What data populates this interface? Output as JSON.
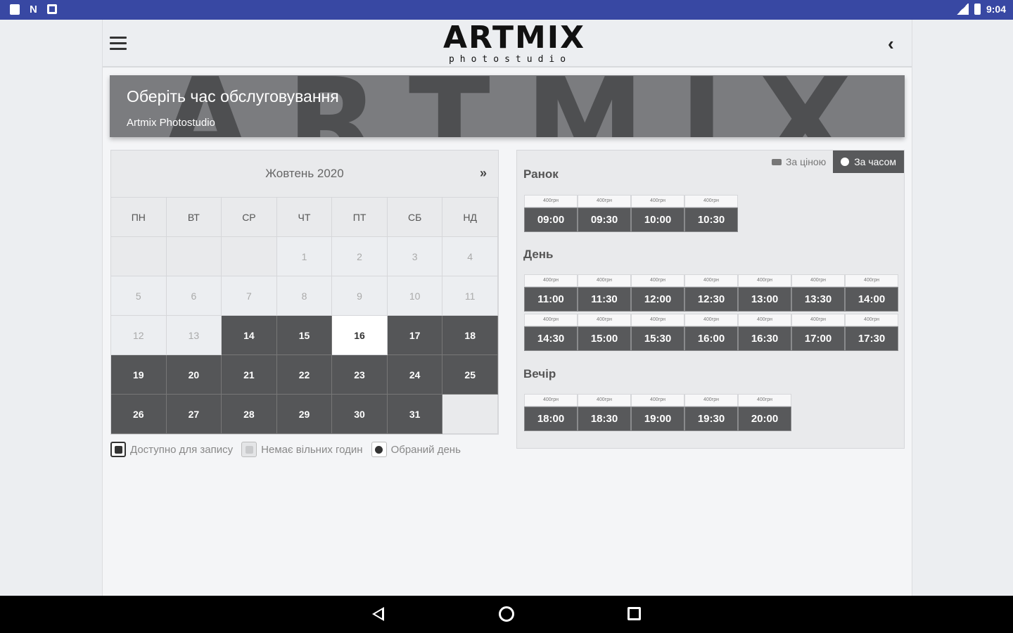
{
  "status_bar": {
    "time": "9:04"
  },
  "header": {
    "logo_main": "ARTMIX",
    "logo_sub": "photostudio"
  },
  "banner": {
    "title": "Оберіть час обслуговування",
    "subtitle": "Artmix Photostudio",
    "watermark": "ARTMIX"
  },
  "calendar": {
    "month": "Жовтень 2020",
    "next_label": "»",
    "weekdays": [
      "ПН",
      "ВТ",
      "СР",
      "ЧТ",
      "ПТ",
      "СБ",
      "НД"
    ],
    "days": [
      {
        "d": "",
        "s": "empty"
      },
      {
        "d": "",
        "s": "empty"
      },
      {
        "d": "",
        "s": "empty"
      },
      {
        "d": "1",
        "s": "off"
      },
      {
        "d": "2",
        "s": "off"
      },
      {
        "d": "3",
        "s": "off"
      },
      {
        "d": "4",
        "s": "off"
      },
      {
        "d": "5",
        "s": "off"
      },
      {
        "d": "6",
        "s": "off"
      },
      {
        "d": "7",
        "s": "off"
      },
      {
        "d": "8",
        "s": "off"
      },
      {
        "d": "9",
        "s": "off"
      },
      {
        "d": "10",
        "s": "off"
      },
      {
        "d": "11",
        "s": "off"
      },
      {
        "d": "12",
        "s": "off"
      },
      {
        "d": "13",
        "s": "off"
      },
      {
        "d": "14",
        "s": "av"
      },
      {
        "d": "15",
        "s": "av"
      },
      {
        "d": "16",
        "s": "sel"
      },
      {
        "d": "17",
        "s": "av"
      },
      {
        "d": "18",
        "s": "av"
      },
      {
        "d": "19",
        "s": "av"
      },
      {
        "d": "20",
        "s": "av"
      },
      {
        "d": "21",
        "s": "av"
      },
      {
        "d": "22",
        "s": "av"
      },
      {
        "d": "23",
        "s": "av"
      },
      {
        "d": "24",
        "s": "av"
      },
      {
        "d": "25",
        "s": "av"
      },
      {
        "d": "26",
        "s": "av"
      },
      {
        "d": "27",
        "s": "av"
      },
      {
        "d": "28",
        "s": "av"
      },
      {
        "d": "29",
        "s": "av"
      },
      {
        "d": "30",
        "s": "av"
      },
      {
        "d": "31",
        "s": "av"
      },
      {
        "d": "",
        "s": "empty"
      }
    ]
  },
  "legend": {
    "available": "Доступно для запису",
    "no_hours": "Немає вільних годин",
    "selected": "Обраний день"
  },
  "timepanel": {
    "by_price": "За ціною",
    "by_time": "За часом",
    "sections": [
      {
        "title": "Ранок",
        "slots": [
          {
            "price": "400грн",
            "time": "09:00"
          },
          {
            "price": "400грн",
            "time": "09:30"
          },
          {
            "price": "400грн",
            "time": "10:00"
          },
          {
            "price": "400грн",
            "time": "10:30"
          }
        ]
      },
      {
        "title": "День",
        "slots": [
          {
            "price": "400грн",
            "time": "11:00"
          },
          {
            "price": "400грн",
            "time": "11:30"
          },
          {
            "price": "400грн",
            "time": "12:00"
          },
          {
            "price": "400грн",
            "time": "12:30"
          },
          {
            "price": "400грн",
            "time": "13:00"
          },
          {
            "price": "400грн",
            "time": "13:30"
          },
          {
            "price": "400грн",
            "time": "14:00"
          },
          {
            "price": "400грн",
            "time": "14:30"
          },
          {
            "price": "400грн",
            "time": "15:00"
          },
          {
            "price": "400грн",
            "time": "15:30"
          },
          {
            "price": "400грн",
            "time": "16:00"
          },
          {
            "price": "400грн",
            "time": "16:30"
          },
          {
            "price": "400грн",
            "time": "17:00"
          },
          {
            "price": "400грн",
            "time": "17:30"
          }
        ]
      },
      {
        "title": "Вечір",
        "slots": [
          {
            "price": "400грн",
            "time": "18:00"
          },
          {
            "price": "400грн",
            "time": "18:30"
          },
          {
            "price": "400грн",
            "time": "19:00"
          },
          {
            "price": "400грн",
            "time": "19:30"
          },
          {
            "price": "400грн",
            "time": "20:00"
          }
        ]
      }
    ]
  },
  "colors": {
    "status_bar": "#3848a3",
    "available_day": "#555658",
    "selected_day": "#ffffff",
    "slot_bg": "#58595b"
  },
  "icons": {
    "menu": "hamburger-icon",
    "back": "chevron-left-icon",
    "by_price": "money-icon",
    "by_time": "clock-icon"
  }
}
